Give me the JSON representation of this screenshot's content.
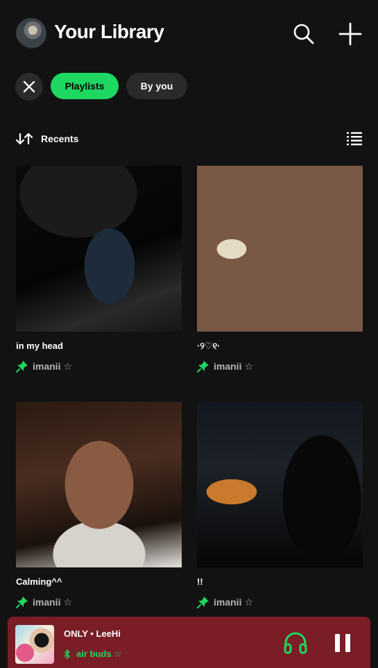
{
  "header": {
    "title": "Your Library"
  },
  "filters": {
    "playlists": "Playlists",
    "by_you": "By you"
  },
  "sort": {
    "label": "Recents"
  },
  "playlists": [
    {
      "title": "in my head",
      "owner": "imanii ☆"
    },
    {
      "title": "·୨♡୧·",
      "owner": "imanii ☆"
    },
    {
      "title": "Calming^^",
      "owner": "imanii ☆"
    },
    {
      "title": "!!",
      "owner": "imanii ☆"
    }
  ],
  "now_playing": {
    "title": "ONLY • LeeHi",
    "device": "air buds ☆"
  },
  "colors": {
    "accent": "#1ed760",
    "background": "#121212",
    "player_bg": "#7a1d26"
  }
}
